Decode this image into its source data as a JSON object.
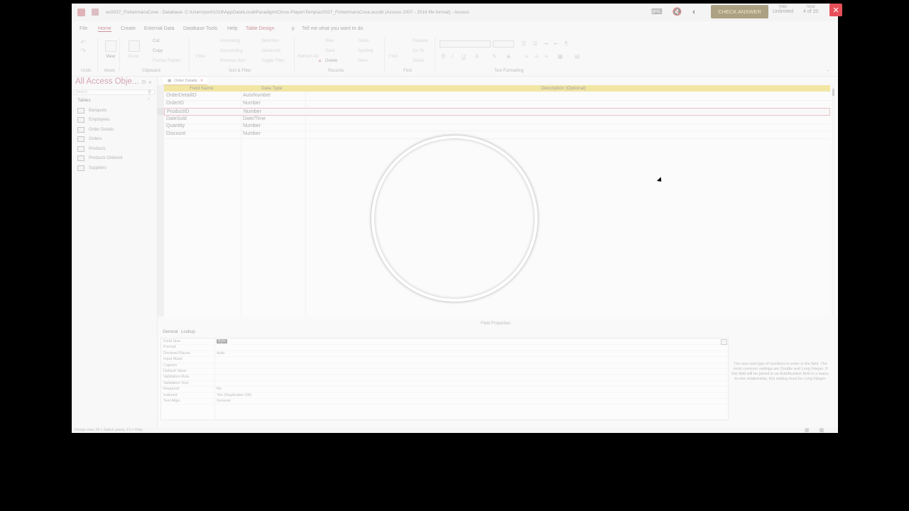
{
  "window": {
    "title": "ac0037_FishermansCove : Database- C:\\Users\\pvd\\1018\\AppData\\Local\\Paradigm\\Cirrus Player\\Temp\\ac0037_FishermansCove.accdb (Access 2007 - 2016 file format) - Access",
    "check_answer": "CHECK ANSWER",
    "time_label": "TIME:",
    "time_value": "Unlimited",
    "task_label": "TASK",
    "task_value": "4 of 20",
    "close": "✕"
  },
  "menu": {
    "items": [
      "File",
      "Home",
      "Create",
      "External Data",
      "Database Tools",
      "Help",
      "Table Design"
    ],
    "tell_me": "Tell me what you want to do"
  },
  "ribbon": {
    "undo": "Undo",
    "views": "Views",
    "view": "View",
    "paste": "Paste",
    "cut": "Cut",
    "copy": "Copy",
    "format_painter": "Format Painter",
    "clipboard": "Clipboard",
    "filter": "Filter",
    "ascending": "Ascending",
    "descending": "Descending",
    "remove_sort": "Remove Sort",
    "selection": "Selection",
    "advanced": "Advanced",
    "toggle_filter": "Toggle Filter",
    "sort_filter": "Sort & Filter",
    "refresh_all": "Refresh All",
    "new": "New",
    "save": "Save",
    "delete": "Delete",
    "totals": "Totals",
    "spelling": "Spelling",
    "more": "More",
    "records": "Records",
    "find": "Find",
    "replace": "Replace",
    "goto": "Go To",
    "select": "Select",
    "find_group": "Find",
    "text_formatting": "Text Formatting"
  },
  "nav": {
    "title": "All Access Obje...",
    "search_placeholder": "Search...",
    "section": "Tables",
    "items": [
      "Banquets",
      "Employees",
      "Order Details",
      "Orders",
      "Products",
      "Products Ordered",
      "Suppliers"
    ]
  },
  "doc": {
    "tab": "Order Details",
    "columns": {
      "field_name": "Field Name",
      "data_type": "Data Type",
      "description": "Description (Optional)"
    },
    "rows": [
      {
        "field": "OrderDetailID",
        "type": "AutoNumber"
      },
      {
        "field": "OrderID",
        "type": "Number"
      },
      {
        "field": "ProductID",
        "type": "Number"
      },
      {
        "field": "DateSold",
        "type": "Date/Time"
      },
      {
        "field": "Quantity",
        "type": "Number"
      },
      {
        "field": "Discount",
        "type": "Number"
      }
    ],
    "field_properties_label": "Field Properties",
    "prop_tabs": [
      "General",
      "Lookup"
    ],
    "properties": [
      {
        "k": "Field Size",
        "v": "Byte"
      },
      {
        "k": "Format",
        "v": ""
      },
      {
        "k": "Decimal Places",
        "v": "Auto"
      },
      {
        "k": "Input Mask",
        "v": ""
      },
      {
        "k": "Caption",
        "v": ""
      },
      {
        "k": "Default Value",
        "v": ""
      },
      {
        "k": "Validation Rule",
        "v": ""
      },
      {
        "k": "Validation Text",
        "v": ""
      },
      {
        "k": "Required",
        "v": "No"
      },
      {
        "k": "Indexed",
        "v": "Yes (Duplicates OK)"
      },
      {
        "k": "Text Align",
        "v": "General"
      }
    ],
    "help_text": "The size and type of numbers to enter in the field. The most common settings are Double and Long Integer. If this field will be joined to an AutoNumber field in a many-to-one relationship, this setting must be Long Integer."
  },
  "status": {
    "text": "Design view.  F6 = Switch panes.  F1 = Help."
  }
}
